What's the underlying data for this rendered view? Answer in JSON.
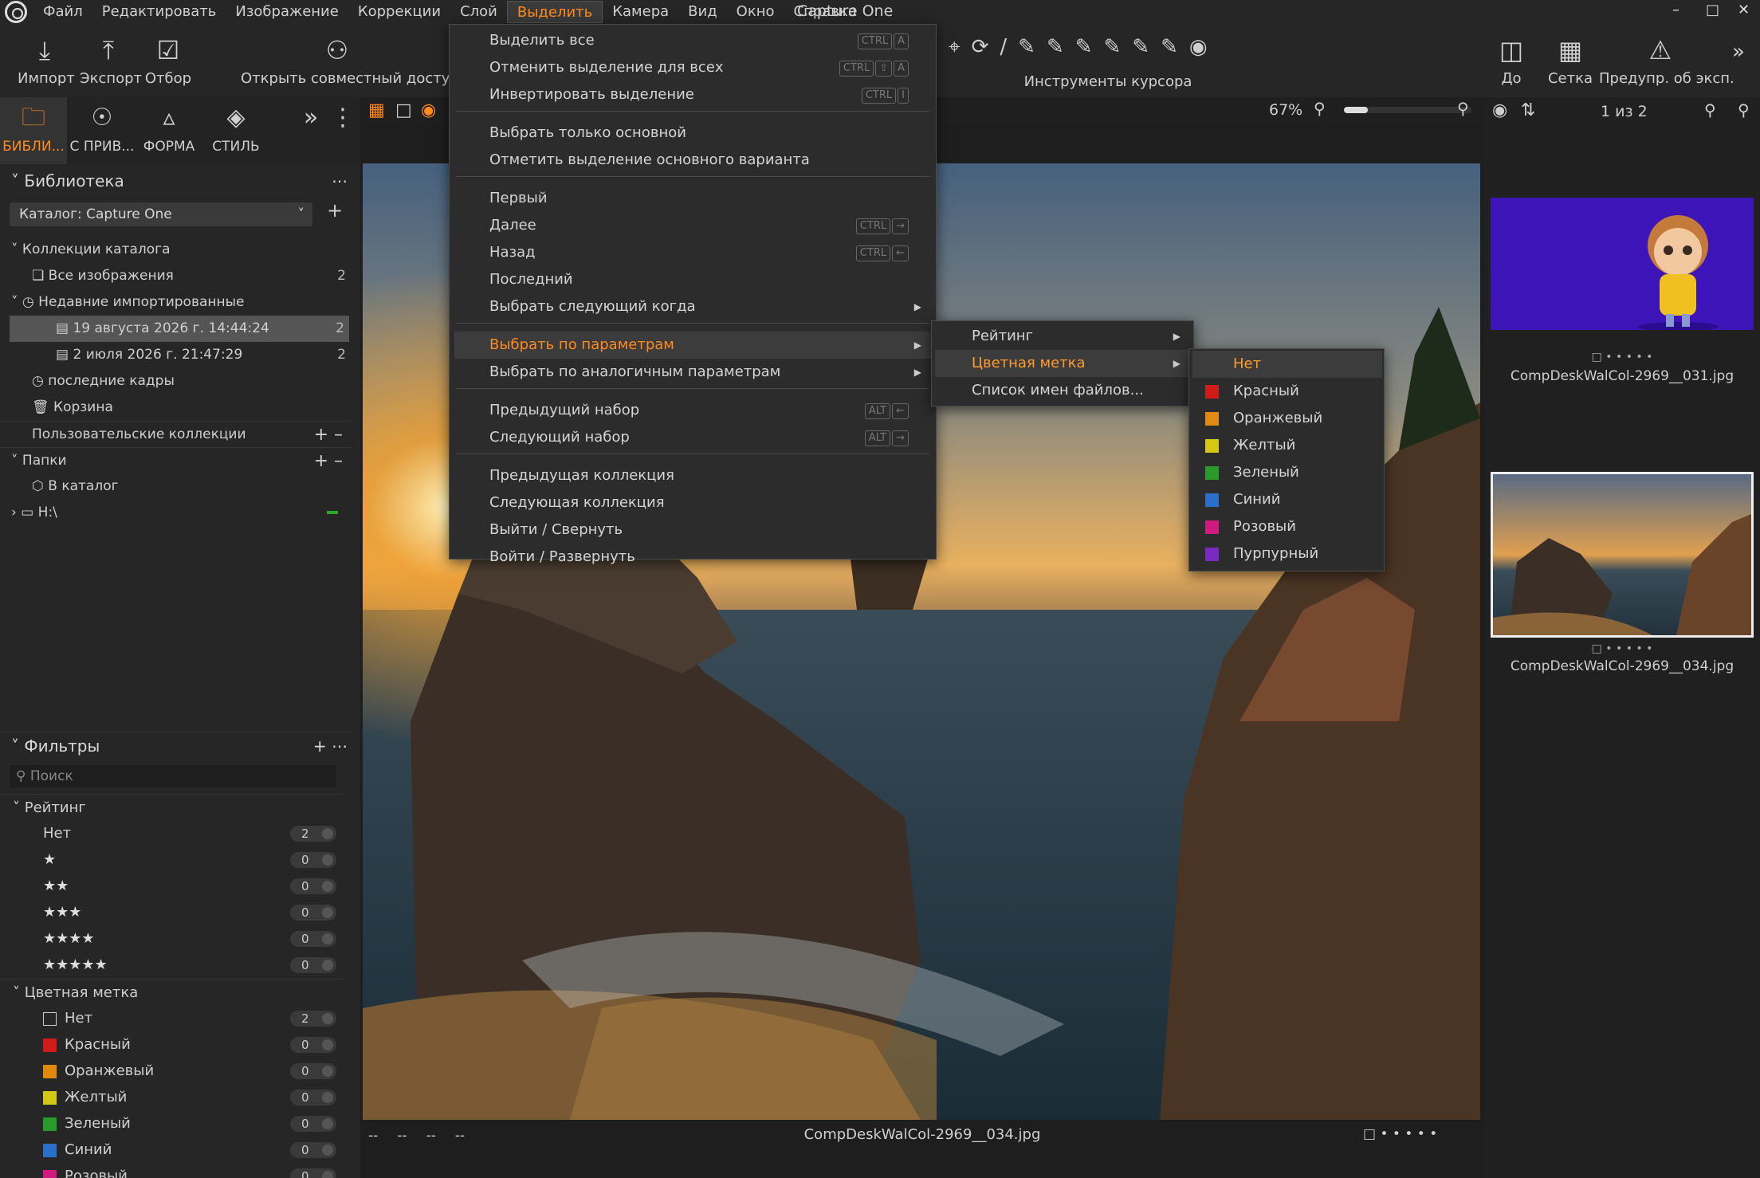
{
  "menubar": {
    "items": [
      "Файл",
      "Редактировать",
      "Изображение",
      "Коррекции",
      "Слой",
      "Выделить",
      "Камера",
      "Вид",
      "Окно",
      "Справка"
    ],
    "active_index": 5,
    "app_title": "Capture One"
  },
  "toolbar": {
    "import": "Импорт",
    "export": "Экспорт",
    "cull": "Отбор",
    "share": "Открыть совместный доступ",
    "cursor_tools": "Инструменты курсора",
    "before": "До",
    "grid": "Сетка",
    "exposure_warning": "Предупр. об эксп."
  },
  "tabs": [
    "БИБЛИ...",
    "С ПРИВ...",
    "ФОРМА",
    "СТИЛЬ"
  ],
  "library": {
    "title": "Библиотека",
    "catalog": "Каталог: Capture One",
    "catalog_collections": "Коллекции каталога",
    "all_images": {
      "label": "Все изображения",
      "count": "2"
    },
    "recent_imports": "Недавние импортированные",
    "imports": [
      {
        "label": "19 августа 2026 г. 14:44:24",
        "count": "2"
      },
      {
        "label": "2 июля 2026 г. 21:47:29",
        "count": "2"
      }
    ],
    "recent_captures": "последние кадры",
    "trash": "Корзина",
    "user_collections": "Пользовательские коллекции",
    "folders": "Папки",
    "in_catalog": "В каталог",
    "drive": "H:\\"
  },
  "filters": {
    "title": "Фильтры",
    "search_placeholder": "Поиск",
    "rating_title": "Рейтинг",
    "ratings": [
      {
        "label": "Нет",
        "stars": 0,
        "count": "2"
      },
      {
        "label": "",
        "stars": 1,
        "count": "0"
      },
      {
        "label": "",
        "stars": 2,
        "count": "0"
      },
      {
        "label": "",
        "stars": 3,
        "count": "0"
      },
      {
        "label": "",
        "stars": 4,
        "count": "0"
      },
      {
        "label": "",
        "stars": 5,
        "count": "0"
      }
    ],
    "color_title": "Цветная метка",
    "colors": [
      {
        "label": "Нет",
        "color": "none",
        "count": "2"
      },
      {
        "label": "Красный",
        "color": "#d11a1a",
        "count": "0"
      },
      {
        "label": "Оранжевый",
        "color": "#e08a10",
        "count": "0"
      },
      {
        "label": "Желтый",
        "color": "#d4c814",
        "count": "0"
      },
      {
        "label": "Зеленый",
        "color": "#2a9a2a",
        "count": "0"
      },
      {
        "label": "Синий",
        "color": "#2a70c8",
        "count": "0"
      },
      {
        "label": "Розовый",
        "color": "#d01a80",
        "count": "0"
      }
    ]
  },
  "viewer": {
    "zoom": "67%",
    "filename": "CompDeskWalCol-2969__034.jpg",
    "meta": [
      "--",
      "--",
      "--",
      "--"
    ]
  },
  "browser": {
    "counter": "1 из 2",
    "thumbs": [
      {
        "name": "CompDeskWalCol-2969__031.jpg"
      },
      {
        "name": "CompDeskWalCol-2969__034.jpg"
      }
    ]
  },
  "select_menu": {
    "items": [
      {
        "label": "Выделить все",
        "kbd": [
          "CTRL",
          "A"
        ]
      },
      {
        "label": "Отменить выделение для всех",
        "kbd": [
          "CTRL",
          "⇧",
          "A"
        ]
      },
      {
        "label": "Инвертировать выделение",
        "kbd": [
          "CTRL",
          "I"
        ]
      },
      {
        "label": "Выбрать только основной"
      },
      {
        "label": "Отметить выделение основного варианта"
      },
      {
        "label": "Первый"
      },
      {
        "label": "Далее",
        "kbd": [
          "CTRL",
          "→"
        ]
      },
      {
        "label": "Назад",
        "kbd": [
          "CTRL",
          "←"
        ]
      },
      {
        "label": "Последний"
      },
      {
        "label": "Выбрать следующий когда",
        "sub": true
      },
      {
        "label": "Выбрать по параметрам",
        "sub": true,
        "highlight": true
      },
      {
        "label": "Выбрать по аналогичным параметрам",
        "sub": true
      },
      {
        "label": "Предыдущий набор",
        "kbd": [
          "ALT",
          "←"
        ]
      },
      {
        "label": "Следующий набор",
        "kbd": [
          "ALT",
          "→"
        ]
      },
      {
        "label": "Предыдущая коллекция"
      },
      {
        "label": "Следующая коллекция"
      },
      {
        "label": "Выйти / Свернуть"
      },
      {
        "label": "Войти / Развернуть"
      }
    ]
  },
  "params_menu": {
    "items": [
      {
        "label": "Рейтинг",
        "sub": true
      },
      {
        "label": "Цветная метка",
        "sub": true,
        "highlight": true
      },
      {
        "label": "Список имен файлов..."
      }
    ]
  },
  "color_menu": {
    "items": [
      {
        "label": "Нет",
        "color": "none",
        "highlight": true
      },
      {
        "label": "Красный",
        "color": "#d11a1a"
      },
      {
        "label": "Оранжевый",
        "color": "#e08a10"
      },
      {
        "label": "Желтый",
        "color": "#d4c814"
      },
      {
        "label": "Зеленый",
        "color": "#2a9a2a"
      },
      {
        "label": "Синий",
        "color": "#2a70c8"
      },
      {
        "label": "Розовый",
        "color": "#d01a80"
      },
      {
        "label": "Пурпурный",
        "color": "#7a2ac0"
      }
    ]
  }
}
